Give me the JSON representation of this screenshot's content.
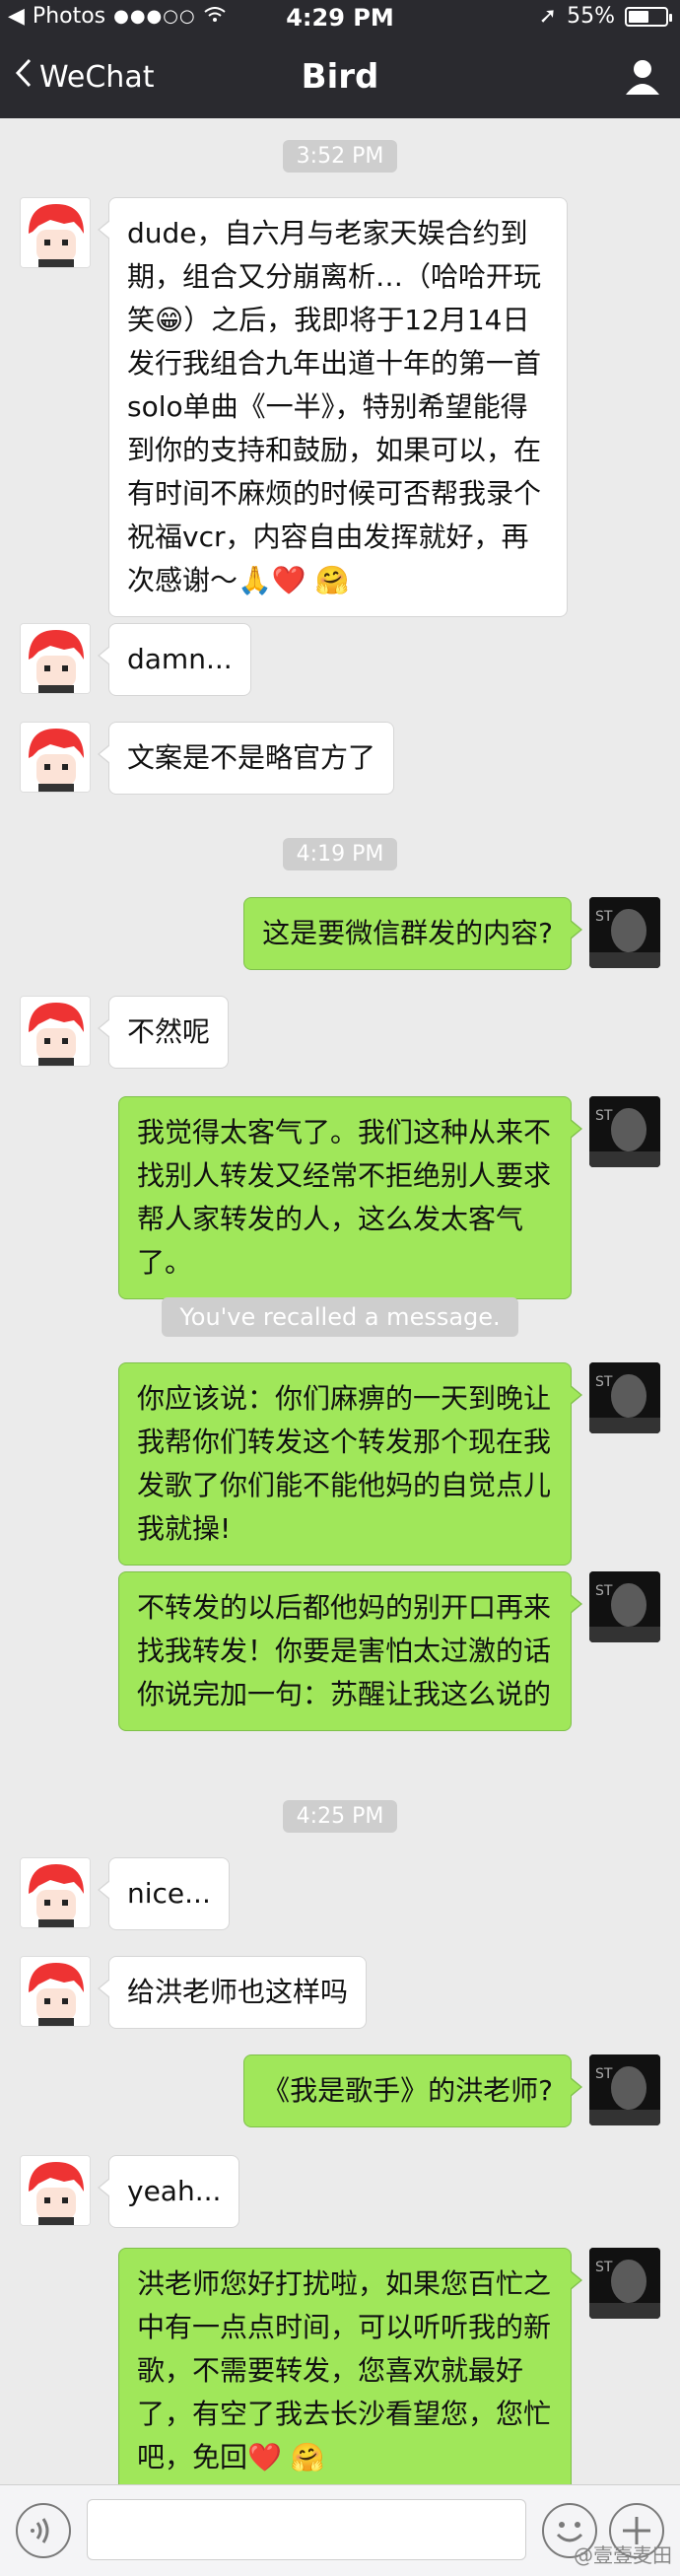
{
  "status": {
    "carrier": "Photos",
    "time": "4:29 PM",
    "battery": "55%"
  },
  "nav": {
    "back_label": "WeChat",
    "title": "Bird"
  },
  "messages": [
    {
      "type": "time",
      "text": "3:52 PM"
    },
    {
      "type": "in",
      "text": "dude，自六月与老家天娱合约到期，组合又分崩离析…（哈哈开玩笑😁）之后，我即将于12月14日发行我组合九年出道十年的第一首solo单曲《一半》，特别希望能得到你的支持和鼓励，如果可以，在有时间不麻烦的时候可否帮我录个祝福vcr，内容自由发挥就好，再次感谢～🙏❤️ 🤗"
    },
    {
      "type": "in",
      "text": "damn..."
    },
    {
      "type": "in",
      "text": "文案是不是略官方了"
    },
    {
      "type": "time",
      "text": "4:19 PM"
    },
    {
      "type": "out",
      "text": "这是要微信群发的内容?"
    },
    {
      "type": "in",
      "text": "不然呢"
    },
    {
      "type": "out",
      "text": "我觉得太客气了。我们这种从来不找别人转发又经常不拒绝别人要求帮人家转发的人，这么发太客气了。"
    },
    {
      "type": "system",
      "text": "You've recalled a message."
    },
    {
      "type": "out",
      "text": "你应该说：你们麻痹的一天到晚让我帮你们转发这个转发那个现在我发歌了你们能不能他妈的自觉点儿我就操!"
    },
    {
      "type": "out",
      "text": "不转发的以后都他妈的别开口再来找我转发！你要是害怕太过激的话你说完加一句：苏醒让我这么说的"
    },
    {
      "type": "time",
      "text": "4:25 PM"
    },
    {
      "type": "in",
      "text": "nice..."
    },
    {
      "type": "in",
      "text": "给洪老师也这样吗"
    },
    {
      "type": "out",
      "text": "《我是歌手》的洪老师?"
    },
    {
      "type": "in",
      "text": "yeah..."
    },
    {
      "type": "out",
      "text": "洪老师您好打扰啦，如果您百忙之中有一点点时间，可以听听我的新歌，不需要转发，您喜欢就最好了，有空了我去长沙看望您，您忙吧，免回❤️ 🤗"
    }
  ],
  "watermark": "@壹壹麦田",
  "icons": {
    "back": "chevron-left-icon",
    "profile": "user-icon",
    "voice": "voice-icon",
    "emoji": "emoji-icon",
    "more": "plus-icon"
  }
}
